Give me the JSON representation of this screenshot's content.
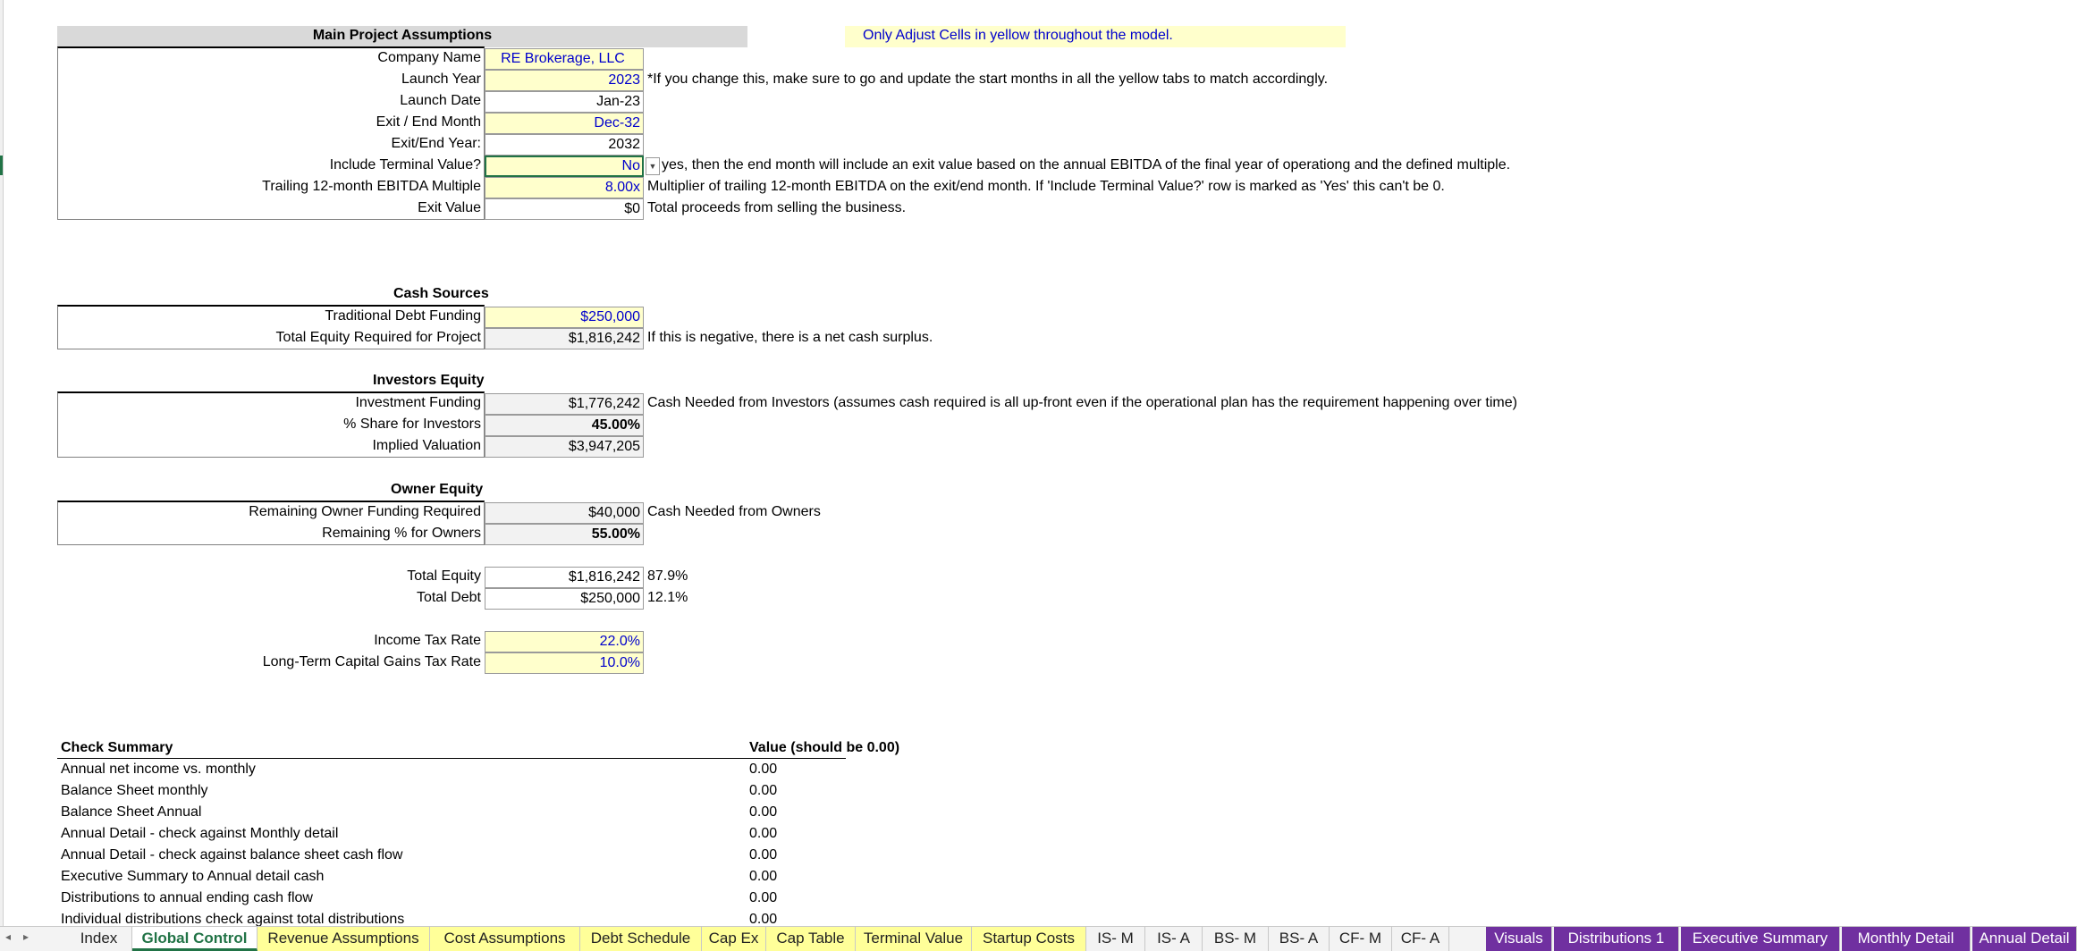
{
  "main": {
    "header": "Main Project Assumptions",
    "notice": "Only Adjust Cells in yellow throughout the model.",
    "rows": [
      {
        "label": "Company Name",
        "value": "RE Brokerage, LLC",
        "note": ""
      },
      {
        "label": "Launch Year",
        "value": "2023",
        "note": "*If you change this, make sure to go and update the start months in all the yellow tabs to match accordingly."
      },
      {
        "label": "Launch Date",
        "value": "Jan-23",
        "note": ""
      },
      {
        "label": "Exit / End Month",
        "value": "Dec-32",
        "note": ""
      },
      {
        "label": "Exit/End Year:",
        "value": "2032",
        "note": ""
      },
      {
        "label": "Include Terminal Value?",
        "value": "No",
        "note": "yes, then the end month will include an exit value based on the annual EBITDA of the final year of operationg and the defined multiple."
      },
      {
        "label": "Trailing 12-month EBITDA Multiple",
        "value": "8.00x",
        "note": "Multiplier of trailing 12-month EBITDA on the exit/end month. If 'Include Terminal Value?' row is marked as 'Yes' this can't be 0."
      },
      {
        "label": "Exit Value",
        "value": "$0",
        "note": "Total proceeds from selling the business."
      }
    ]
  },
  "cash_sources": {
    "header": "Cash Sources",
    "rows": [
      {
        "label": "Traditional Debt Funding",
        "value": "$250,000",
        "note": ""
      },
      {
        "label": "Total Equity Required for Project",
        "value": "$1,816,242",
        "note": "If this is negative, there is a net cash surplus."
      }
    ]
  },
  "investors": {
    "header": "Investors Equity",
    "rows": [
      {
        "label": "Investment Funding",
        "value": "$1,776,242",
        "note": "Cash Needed from Investors (assumes cash required is all up-front even if the operational plan has the requirement happening over time)"
      },
      {
        "label": "% Share for Investors",
        "value": "45.00%",
        "note": ""
      },
      {
        "label": "Implied Valuation",
        "value": "$3,947,205",
        "note": ""
      }
    ]
  },
  "owner": {
    "header": "Owner Equity",
    "rows": [
      {
        "label": "Remaining Owner Funding Required",
        "value": "$40,000",
        "note": "Cash Needed from Owners"
      },
      {
        "label": "Remaining % for Owners",
        "value": "55.00%",
        "note": ""
      }
    ]
  },
  "totals": {
    "rows": [
      {
        "label": "Total Equity",
        "value": "$1,816,242",
        "note": "87.9%"
      },
      {
        "label": "Total Debt",
        "value": "$250,000",
        "note": "12.1%"
      }
    ]
  },
  "tax": {
    "rows": [
      {
        "label": "Income Tax Rate",
        "value": "22.0%"
      },
      {
        "label": "Long-Term Capital Gains Tax Rate",
        "value": "10.0%"
      }
    ]
  },
  "checks": {
    "header": "Check Summary",
    "value_header": "Value (should be 0.00)",
    "rows": [
      {
        "label": "Annual net income vs. monthly",
        "value": "0.00"
      },
      {
        "label": "Balance Sheet monthly",
        "value": "0.00"
      },
      {
        "label": "Balance Sheet Annual",
        "value": "0.00"
      },
      {
        "label": "Annual Detail - check against Monthly detail",
        "value": "0.00"
      },
      {
        "label": "Annual Detail - check against balance sheet cash flow",
        "value": "0.00"
      },
      {
        "label": "Executive Summary to Annual detail cash",
        "value": "0.00"
      },
      {
        "label": "Distributions to annual ending cash flow",
        "value": "0.00"
      },
      {
        "label": "Individual distributions check against total distributions",
        "value": "0.00"
      }
    ]
  },
  "tabs": [
    {
      "label": "Index",
      "style": "normal"
    },
    {
      "label": "Global Control",
      "style": "active"
    },
    {
      "label": "Revenue Assumptions",
      "style": "yellow"
    },
    {
      "label": "Cost Assumptions",
      "style": "yellow"
    },
    {
      "label": "Debt Schedule",
      "style": "yellow"
    },
    {
      "label": "Cap Ex",
      "style": "yellow"
    },
    {
      "label": "Cap Table",
      "style": "yellow"
    },
    {
      "label": "Terminal Value",
      "style": "yellow"
    },
    {
      "label": "Startup Costs",
      "style": "yellow"
    },
    {
      "label": "IS- M",
      "style": "normal"
    },
    {
      "label": "IS- A",
      "style": "normal"
    },
    {
      "label": "BS- M",
      "style": "normal"
    },
    {
      "label": "BS- A",
      "style": "normal"
    },
    {
      "label": "CF- M",
      "style": "normal"
    },
    {
      "label": "CF- A",
      "style": "normal"
    },
    {
      "label": "Visuals",
      "style": "purple"
    },
    {
      "label": "Distributions 1",
      "style": "purple"
    },
    {
      "label": "Executive Summary",
      "style": "purple"
    },
    {
      "label": "Monthly Detail",
      "style": "purple"
    },
    {
      "label": "Annual Detail",
      "style": "purple"
    }
  ],
  "colors": {
    "input_fill": "#ffffcc",
    "calc_fill": "#f2f2f2",
    "input_font": "#0000cc",
    "accent": "#217346",
    "purple_tab": "#7030a0"
  }
}
